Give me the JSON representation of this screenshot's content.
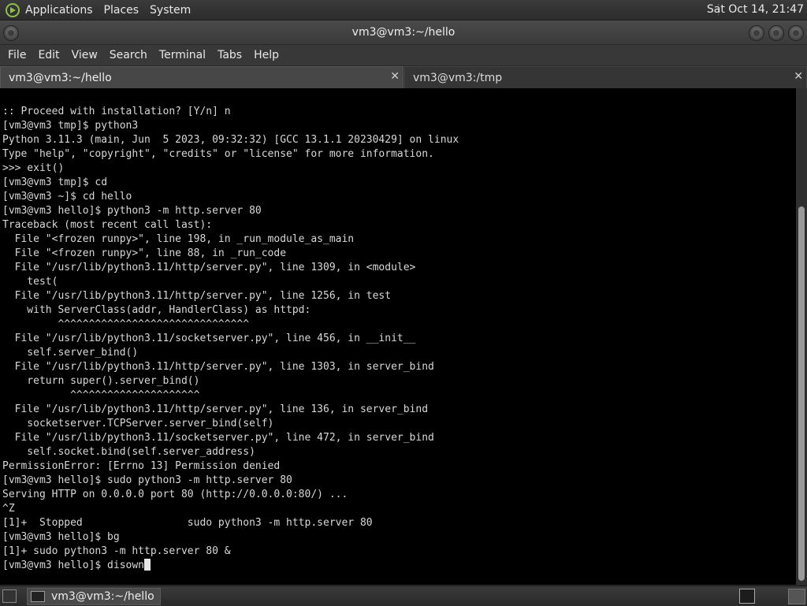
{
  "top_panel": {
    "menus": [
      "Applications",
      "Places",
      "System"
    ],
    "clock": "Sat Oct 14, 21:47"
  },
  "window": {
    "title": "vm3@vm3:~/hello"
  },
  "menubar": {
    "items": [
      "File",
      "Edit",
      "View",
      "Search",
      "Terminal",
      "Tabs",
      "Help"
    ]
  },
  "tabs": [
    {
      "label": "vm3@vm3:~/hello",
      "close": "✕"
    },
    {
      "label": "vm3@vm3:/tmp",
      "close": "✕"
    }
  ],
  "terminal": {
    "lines": [
      ":: Proceed with installation? [Y/n] n",
      "[vm3@vm3 tmp]$ python3",
      "Python 3.11.3 (main, Jun  5 2023, 09:32:32) [GCC 13.1.1 20230429] on linux",
      "Type \"help\", \"copyright\", \"credits\" or \"license\" for more information.",
      ">>> exit()",
      "[vm3@vm3 tmp]$ cd",
      "[vm3@vm3 ~]$ cd hello",
      "[vm3@vm3 hello]$ python3 -m http.server 80",
      "Traceback (most recent call last):",
      "  File \"<frozen runpy>\", line 198, in _run_module_as_main",
      "  File \"<frozen runpy>\", line 88, in _run_code",
      "  File \"/usr/lib/python3.11/http/server.py\", line 1309, in <module>",
      "    test(",
      "  File \"/usr/lib/python3.11/http/server.py\", line 1256, in test",
      "    with ServerClass(addr, HandlerClass) as httpd:",
      "         ^^^^^^^^^^^^^^^^^^^^^^^^^^^^^^^",
      "  File \"/usr/lib/python3.11/socketserver.py\", line 456, in __init__",
      "    self.server_bind()",
      "  File \"/usr/lib/python3.11/http/server.py\", line 1303, in server_bind",
      "    return super().server_bind()",
      "           ^^^^^^^^^^^^^^^^^^^^^",
      "  File \"/usr/lib/python3.11/http/server.py\", line 136, in server_bind",
      "    socketserver.TCPServer.server_bind(self)",
      "  File \"/usr/lib/python3.11/socketserver.py\", line 472, in server_bind",
      "    self.socket.bind(self.server_address)",
      "PermissionError: [Errno 13] Permission denied",
      "[vm3@vm3 hello]$ sudo python3 -m http.server 80",
      "Serving HTTP on 0.0.0.0 port 80 (http://0.0.0.0:80/) ...",
      "^Z",
      "[1]+  Stopped                 sudo python3 -m http.server 80",
      "[vm3@vm3 hello]$ bg",
      "[1]+ sudo python3 -m http.server 80 &"
    ],
    "current_prompt": "[vm3@vm3 hello]$ disown"
  },
  "taskbar": {
    "items": [
      "vm3@vm3:~/hello"
    ]
  },
  "icons": {
    "logo": "gnome-foot-icon",
    "show_desktop": "show-desktop-icon",
    "terminal_tray": "terminal-icon"
  }
}
